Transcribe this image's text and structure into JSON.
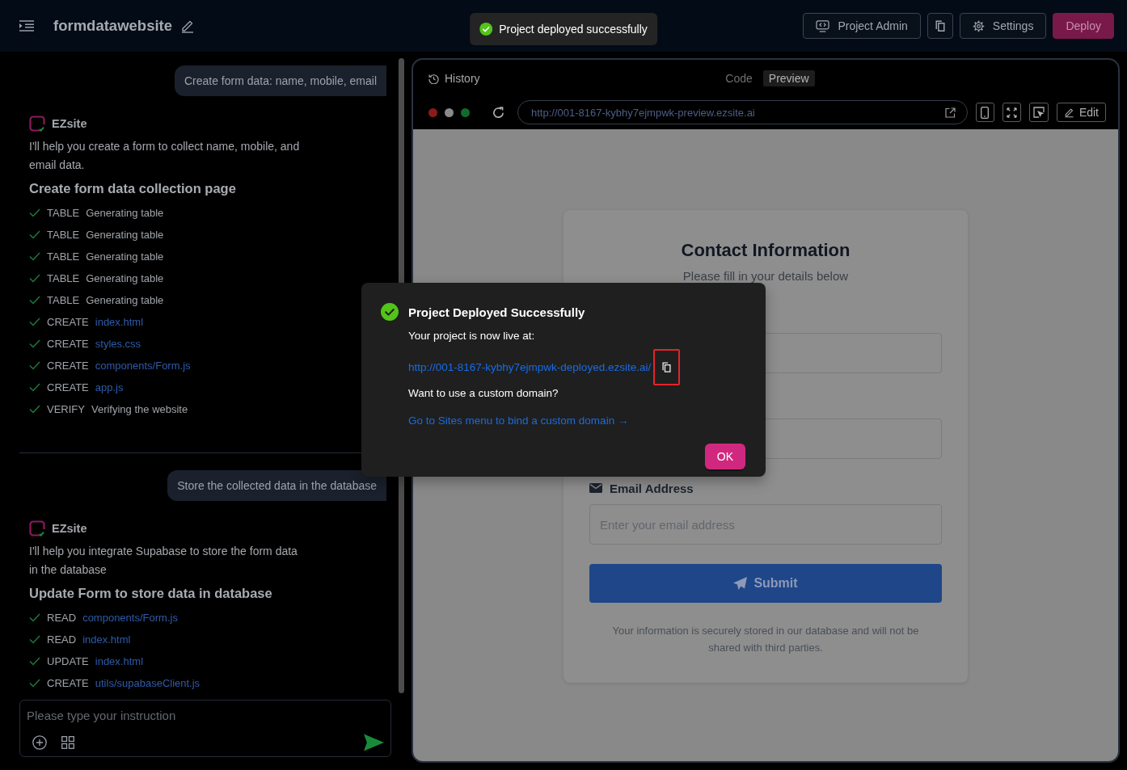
{
  "top_bar": {
    "project_name": "formdatawebsite",
    "buttons": [
      {
        "kind": "admin",
        "label": "Project Admin"
      },
      {
        "kind": "copy"
      },
      {
        "kind": "settings",
        "label": "Settings"
      },
      {
        "kind": "deploy",
        "label": "Deploy"
      }
    ]
  },
  "toast": {
    "message": "Project deployed successfully"
  },
  "chat": {
    "messages": [
      {
        "kind": "user",
        "text": "Create form data: name, mobile, email"
      },
      {
        "kind": "assistant",
        "sender": "EZsite",
        "text": "I'll help you create a form to collect name, mobile, and email data.",
        "heading": "Create form data collection page",
        "steps": [
          {
            "action": "TABLE",
            "target": "Generating table",
            "kind": "text",
            "done": true
          },
          {
            "action": "TABLE",
            "target": "Generating table",
            "kind": "text",
            "done": true
          },
          {
            "action": "TABLE",
            "target": "Generating table",
            "kind": "text",
            "done": true
          },
          {
            "action": "TABLE",
            "target": "Generating table",
            "kind": "text",
            "done": true
          },
          {
            "action": "TABLE",
            "target": "Generating table",
            "kind": "text",
            "done": true
          },
          {
            "action": "CREATE",
            "target": "index.html",
            "kind": "file",
            "done": true
          },
          {
            "action": "CREATE",
            "target": "styles.css",
            "kind": "file",
            "done": true
          },
          {
            "action": "CREATE",
            "target": "components/Form.js",
            "kind": "file",
            "done": true
          },
          {
            "action": "CREATE",
            "target": "app.js",
            "kind": "file",
            "done": true
          },
          {
            "action": "VERIFY",
            "target": "Verifying the website",
            "kind": "text",
            "done": true
          }
        ]
      },
      {
        "kind": "user",
        "text": "Store the collected data in the database"
      },
      {
        "kind": "assistant",
        "sender": "EZsite",
        "text": "I'll help you integrate Supabase to store the form data in the database",
        "heading": "Update Form to store data in database",
        "steps": [
          {
            "action": "READ",
            "target": "components/Form.js",
            "kind": "file",
            "done": true
          },
          {
            "action": "READ",
            "target": "index.html",
            "kind": "file",
            "done": true
          },
          {
            "action": "UPDATE",
            "target": "index.html",
            "kind": "file",
            "done": true
          },
          {
            "action": "CREATE",
            "target": "utils/supabaseClient.js",
            "kind": "file",
            "done": true
          }
        ]
      }
    ],
    "composer": {
      "placeholder": "Please type your instruction"
    }
  },
  "preview": {
    "history_label": "History",
    "tabs": [
      {
        "label": "Code",
        "selected": false
      },
      {
        "label": "Preview",
        "selected": true
      }
    ],
    "url": "http://001-8167-kybhy7ejmpwk-preview.ezsite.ai",
    "tools": [
      {
        "kind": "mobile"
      },
      {
        "kind": "fullscreen"
      },
      {
        "kind": "select"
      },
      {
        "kind": "edit",
        "label": "Edit"
      }
    ],
    "page": {
      "title": "Contact Information",
      "subtitle": "Please fill in your details below",
      "fields": [
        {
          "kind": "text"
        },
        {
          "kind": "text"
        },
        {
          "kind": "email",
          "label": "Email Address",
          "placeholder": "Enter your email address"
        }
      ],
      "submit_label": "Submit",
      "note": "Your information is securely stored in our database and will not be shared with third parties."
    }
  },
  "modal": {
    "title": "Project Deployed Successfully",
    "intro": "Your project is now live at:",
    "url": "http://001-8167-kybhy7ejmpwk-deployed.ezsite.ai/",
    "copy_highlighted": true,
    "question": "Want to use a custom domain?",
    "link": "Go to Sites menu to bind a custom domain →",
    "ok_label": "OK"
  }
}
